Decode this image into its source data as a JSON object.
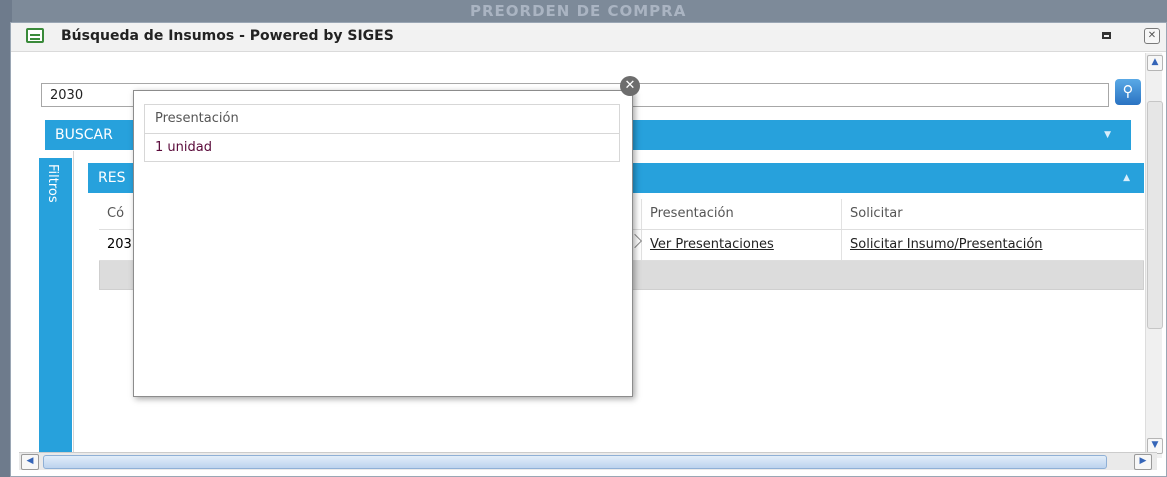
{
  "background": {
    "title": "PREORDEN DE COMPRA"
  },
  "window": {
    "title": "Búsqueda de Insumos - Powered by SIGES",
    "maximize_icon": "maximize-icon",
    "close_icon": "close-icon"
  },
  "search": {
    "value": "2030",
    "button_icon": "search-icon"
  },
  "buscar_panel": {
    "label": "BUSCAR"
  },
  "filters_tab": {
    "label": "Filtros"
  },
  "results_panel": {
    "label": "RES",
    "columns": [
      "Có",
      "Presentación",
      "Solicitar"
    ],
    "rows": [
      {
        "code": "203",
        "presentations_link": "Ver Presentaciones",
        "request_link": "Solicitar Insumo/Presentación"
      }
    ]
  },
  "popup": {
    "header": "Presentación",
    "items": [
      "1 unidad"
    ],
    "close_icon": "close-circle-icon"
  },
  "colors": {
    "accent": "#27a1dc",
    "popup_text": "#5a0a3a"
  }
}
